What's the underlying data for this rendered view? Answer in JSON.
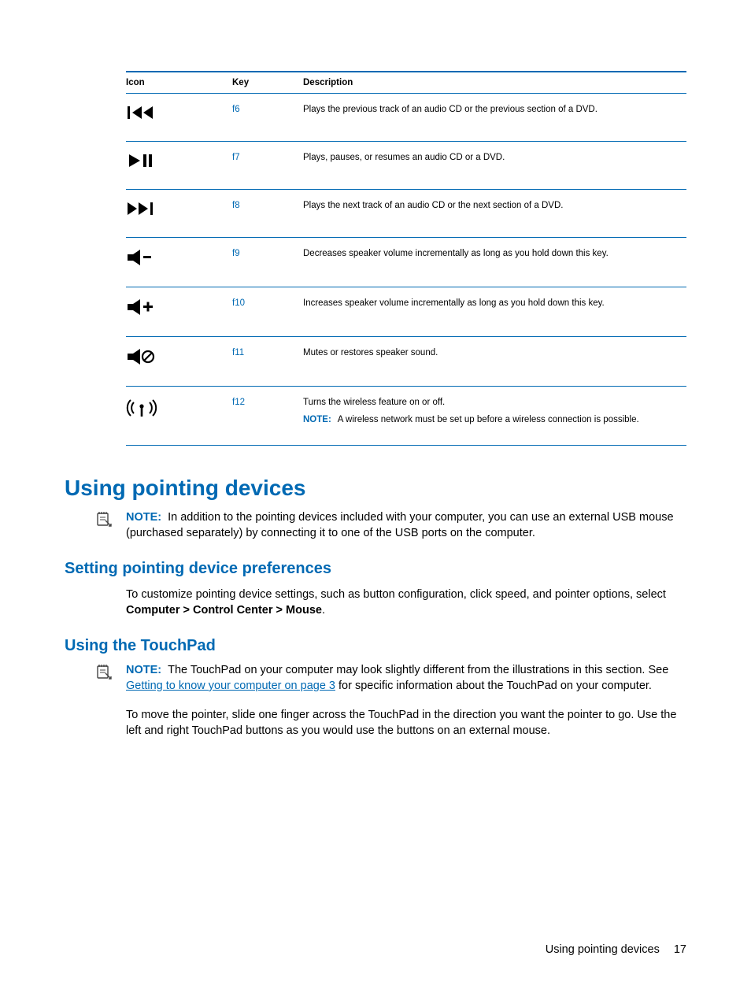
{
  "table": {
    "headers": {
      "icon": "Icon",
      "key": "Key",
      "description": "Description"
    },
    "rows": [
      {
        "key": "f6",
        "description": "Plays the previous track of an audio CD or the previous section of a DVD."
      },
      {
        "key": "f7",
        "description": "Plays, pauses, or resumes an audio CD or a DVD."
      },
      {
        "key": "f8",
        "description": "Plays the next track of an audio CD or the next section of a DVD."
      },
      {
        "key": "f9",
        "description": "Decreases speaker volume incrementally as long as you hold down this key."
      },
      {
        "key": "f10",
        "description": "Increases speaker volume incrementally as long as you hold down this key."
      },
      {
        "key": "f11",
        "description": "Mutes or restores speaker sound."
      },
      {
        "key": "f12",
        "description": "Turns the wireless feature on or off.",
        "note_label": "NOTE:",
        "note_text": "A wireless network must be set up before a wireless connection is possible."
      }
    ]
  },
  "heading1": "Using pointing devices",
  "note1": {
    "label": "NOTE:",
    "text": "In addition to the pointing devices included with your computer, you can use an external USB mouse (purchased separately) by connecting it to one of the USB ports on the computer."
  },
  "heading2a": "Setting pointing device preferences",
  "para1_a": "To customize pointing device settings, such as button configuration, click speed, and pointer options, select ",
  "para1_bold": "Computer > Control Center > Mouse",
  "para1_b": ".",
  "heading2b": "Using the TouchPad",
  "note2": {
    "label": "NOTE:",
    "pre": "The TouchPad on your computer may look slightly different from the illustrations in this section. See ",
    "link": "Getting to know your computer on page 3",
    "post": " for specific information about the TouchPad on your computer."
  },
  "para2": "To move the pointer, slide one finger across the TouchPad in the direction you want the pointer to go. Use the left and right TouchPad buttons as you would use the buttons on an external mouse.",
  "footer": {
    "title": "Using pointing devices",
    "page": "17"
  }
}
